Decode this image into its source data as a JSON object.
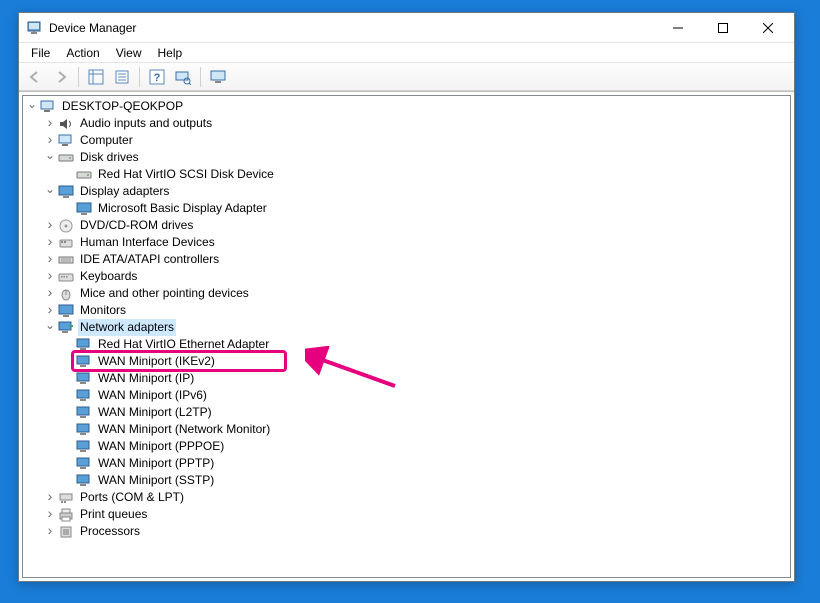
{
  "window": {
    "title": "Device Manager"
  },
  "menu": {
    "file": "File",
    "action": "Action",
    "view": "View",
    "help": "Help"
  },
  "tree": {
    "root": "DESKTOP-QEOKPOP",
    "audio": "Audio inputs and outputs",
    "computer": "Computer",
    "disk": "Disk drives",
    "disk_child": "Red Hat VirtIO SCSI Disk Device",
    "display": "Display adapters",
    "display_child": "Microsoft Basic Display Adapter",
    "dvd": "DVD/CD-ROM drives",
    "hid": "Human Interface Devices",
    "ide": "IDE ATA/ATAPI controllers",
    "keyboards": "Keyboards",
    "mice": "Mice and other pointing devices",
    "monitors": "Monitors",
    "network": "Network adapters",
    "net0": "Red Hat VirtIO Ethernet Adapter",
    "net1": "WAN Miniport (IKEv2)",
    "net2": "WAN Miniport (IP)",
    "net3": "WAN Miniport (IPv6)",
    "net4": "WAN Miniport (L2TP)",
    "net5": "WAN Miniport (Network Monitor)",
    "net6": "WAN Miniport (PPPOE)",
    "net7": "WAN Miniport (PPTP)",
    "net8": "WAN Miniport (SSTP)",
    "ports": "Ports (COM & LPT)",
    "printq": "Print queues",
    "processors": "Processors"
  }
}
